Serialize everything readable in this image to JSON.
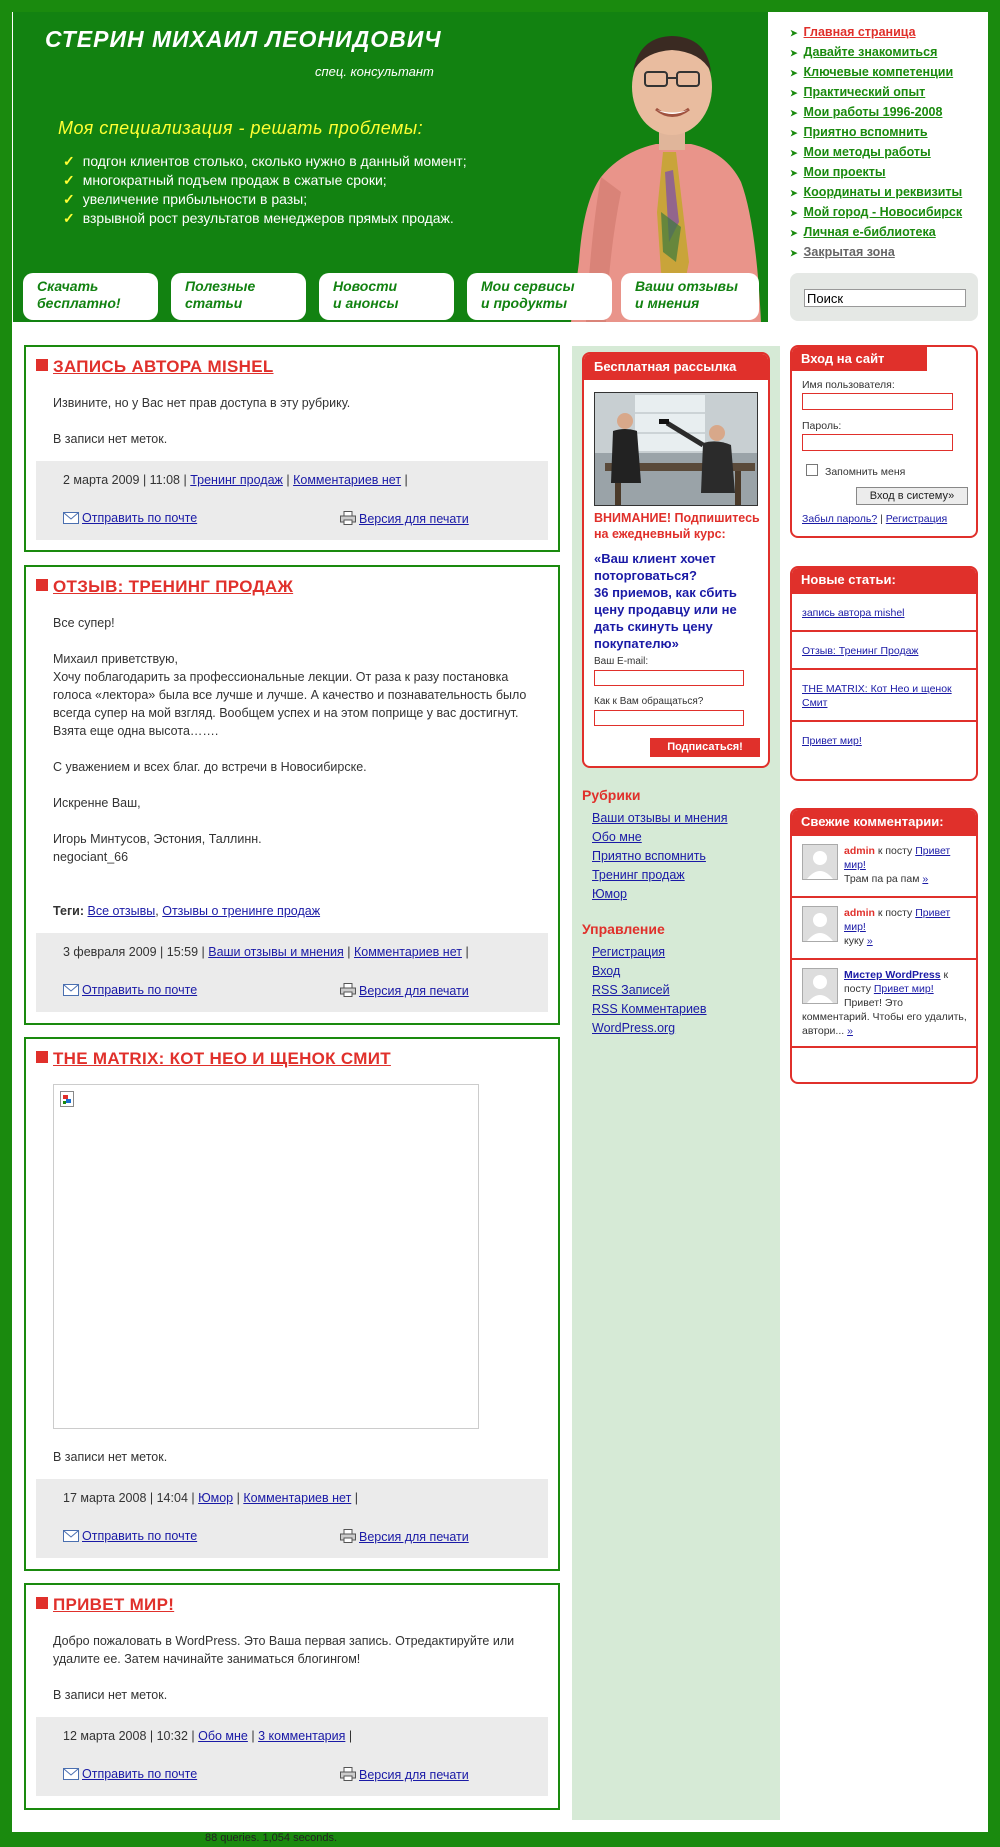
{
  "header": {
    "name": "СТЕРИН МИХАИЛ ЛЕОНИДОВИЧ",
    "role": "спец. консультант",
    "specialization": "Моя специализация - решать проблемы:",
    "points": [
      "подгон клиентов столько, сколько нужно в данный момент;",
      "многократный подъем продаж в сжатые сроки;",
      "увеличение прибыльности в разы;",
      "взрывной рост результатов менеджеров прямых продаж."
    ],
    "buttons": [
      {
        "line1": "Скачать",
        "line2": "бесплатно!"
      },
      {
        "line1": "Полезные",
        "line2": "статьи"
      },
      {
        "line1": "Новости",
        "line2": "и анонсы"
      },
      {
        "line1": "Мои сервисы",
        "line2": "и продукты"
      },
      {
        "line1": "Ваши отзывы",
        "line2": "и мнения"
      }
    ]
  },
  "nav": [
    "Главная страница",
    "Давайте знакомиться",
    "Ключевые компетенции",
    "Практический опыт",
    "Мои работы 1996-2008",
    "Приятно вспомнить",
    "Мои методы работы",
    "Мои проекты",
    "Координаты и реквизиты",
    "Мой город - Новосибирск",
    "Личная е-библиотека",
    "Закрытая зона"
  ],
  "search": {
    "value": "Поиск"
  },
  "common": {
    "send_mail": "Отправить по почте",
    "print_version": "Версия для печати",
    "no_tags": "В записи нет меток."
  },
  "posts": [
    {
      "title": "ЗАПИСЬ АВТОРА MISHEL",
      "text": "Извините, но у Вас нет прав доступа в эту рубрику.",
      "date": "2 марта 2009 | 11:08 |",
      "category": "Тренинг продаж",
      "comments": "Комментариев нет"
    },
    {
      "title": "ОТЗЫВ: ТРЕНИНГ ПРОДАЖ",
      "p1": "Все супер!",
      "p2": "Михаил приветствую,\nХочу поблагодарить за профессиональные лекции. От раза к разу постановка голоса «лектора» была все лучше и лучше. А качество и познавательность было всегда супер на мой взгляд. Вообщем успех и на этом поприще у вас достигнут. Взята еще одна высота…….",
      "p3": "С уважением и всех благ. до встречи в Новосибирске.",
      "p4": "Искренне Ваш,",
      "p5": "Игорь Минтусов, Эстония, Таллинн.\nnegociant_66",
      "tags_label": "Теги:",
      "tag1": "Все отзывы",
      "tag2": "Отзывы о тренинге продаж",
      "date": "3 февраля 2009 | 15:59 |",
      "category": "Ваши отзывы и мнения",
      "comments": "Комментариев нет"
    },
    {
      "title": "THE MATRIX: КОТ НЕО И ЩЕНОК СМИТ",
      "date": "17 марта 2008 | 14:04 |",
      "category": "Юмор",
      "comments": "Комментариев нет"
    },
    {
      "title": "ПРИВЕТ МИР!",
      "text": "Добро пожаловать в WordPress. Это Ваша первая запись. Отредактируйте или удалите ее. Затем начинайте заниматься блогингом!",
      "date": "12 марта 2008 | 10:32 |",
      "category": "Обо мне",
      "comments": "3 комментария"
    }
  ],
  "mailing": {
    "title": "Бесплатная рассылка",
    "warning": "ВНИМАНИЕ! Подпишитесь на ежедневный курс:",
    "course": "«Ваш клиент хочет поторговаться?\n36 приемов, как сбить цену продавцу или не дать скинуть цену покупателю»",
    "email_label": "Ваш E-mail:",
    "name_label": "Как к Вам обращаться?",
    "submit": "Подписаться!"
  },
  "rubrics": {
    "title": "Рубрики",
    "items": [
      "Ваши отзывы и мнения",
      "Обо мне",
      "Приятно вспомнить",
      "Тренинг продаж",
      "Юмор"
    ]
  },
  "manage": {
    "title": "Управление",
    "items": [
      "Регистрация",
      "Вход",
      "RSS Записей",
      "RSS Комментариев",
      "WordPress.org"
    ]
  },
  "login": {
    "title": "Вход на сайт",
    "user_label": "Имя пользователя:",
    "pass_label": "Пароль:",
    "remember": "Запомнить меня",
    "submit": "Вход в систему»",
    "forgot": "Забыл пароль?",
    "sep": "|",
    "register": "Регистрация"
  },
  "new_articles": {
    "title": "Новые статьи:",
    "items": [
      "запись автора mishel",
      "Отзыв: Тренинг Продаж",
      "THE MATRIX: Кот Нео и щенок Смит",
      "Привет мир!"
    ]
  },
  "recent_comments": {
    "title": "Свежие комментарии:",
    "to_post": "к посту",
    "more": "»",
    "items": [
      {
        "author": "admin",
        "post": "Привет мир!",
        "text": "Трам па ра пам"
      },
      {
        "author": "admin",
        "post": "Привет мир!",
        "text": "куку"
      },
      {
        "author": "Мистер WordPress",
        "post": "Привет мир!",
        "text": "Привет! Это комментарий. Чтобы его удалить, автори..."
      }
    ]
  },
  "footer": {
    "stats": "88 queries. 1,054 seconds."
  },
  "colors": {
    "green": "#1a8a0e",
    "red": "#e0302b",
    "link": "#1a1aa6",
    "yellow": "#ffff33"
  }
}
